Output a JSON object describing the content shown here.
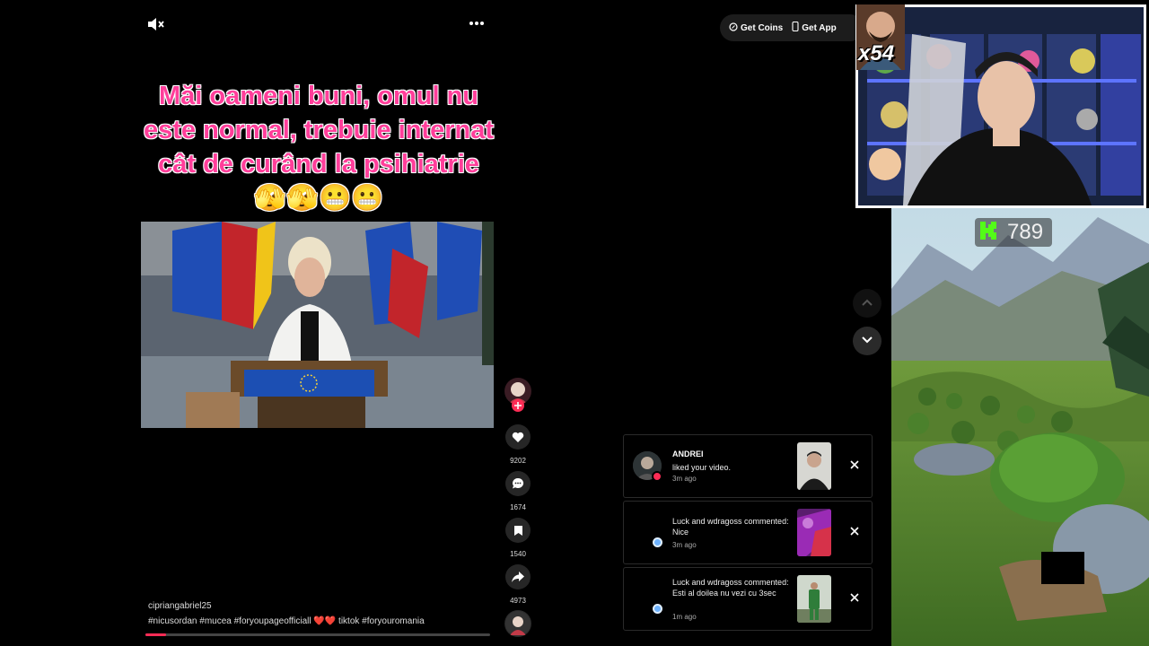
{
  "feed": {
    "caption_overlay": "Măi oameni buni, omul nu este normal, trebuie internat cât de curând la psihiatrie 🫣🫣😬😬",
    "author": "cipriangabriel25",
    "hashtags": "#nicusordan #mucea #foryoupageofficiall ❤️❤️ tiktok #foryouromania",
    "progress_fraction": 0.06
  },
  "actions": {
    "likes": "9202",
    "comments": "1674",
    "saves": "1540",
    "shares": "4973"
  },
  "topbar": {
    "get_coins": "Get Coins",
    "get_app": "Get App"
  },
  "notifications": [
    {
      "name": "ANDREI",
      "text": "liked your video.",
      "time": "3m ago"
    },
    {
      "name": "",
      "text": "Luck and wdragoss commented: Nice",
      "time": "3m ago"
    },
    {
      "name": "",
      "text": "Luck and wdragoss commented: Esti al doilea nu vezi cu 3sec",
      "time": "1m ago"
    }
  ],
  "overlay": {
    "combo": "x54",
    "score": "789"
  },
  "colors": {
    "accent": "#fe2c55",
    "caption": "#ff3e9a",
    "score_icon": "#53fc18"
  }
}
